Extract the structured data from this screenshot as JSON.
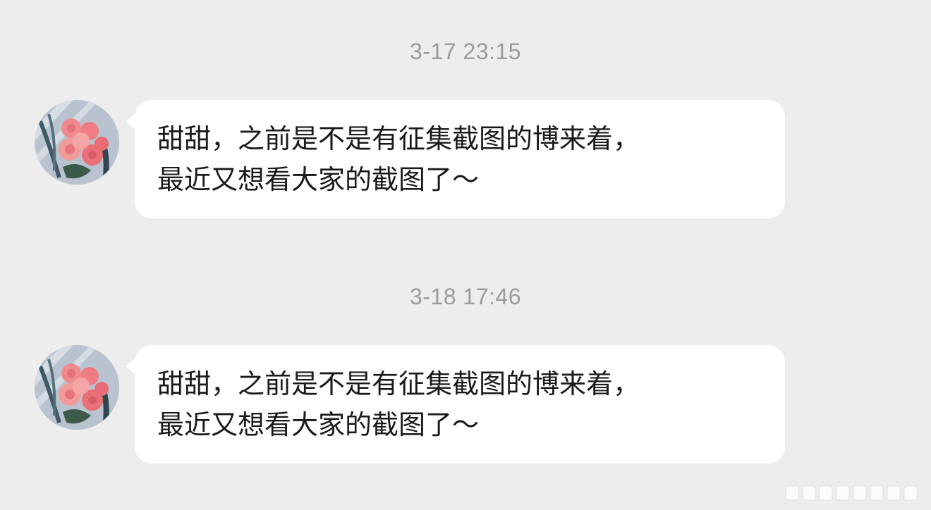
{
  "chat": {
    "messages": [
      {
        "timestamp": "3-17 23:15",
        "avatar_icon": "rose-bouquet-avatar",
        "text": "甜甜，之前是不是有征集截图的博来着，\n最近又想看大家的截图了～"
      },
      {
        "timestamp": "3-18 17:46",
        "avatar_icon": "rose-bouquet-avatar",
        "text": "甜甜，之前是不是有征集截图的博来着，\n最近又想看大家的截图了～"
      }
    ]
  },
  "colors": {
    "background": "#ededed",
    "bubble": "#ffffff",
    "timestamp": "#9b9b9b",
    "message_text": "#1a1a1a"
  }
}
